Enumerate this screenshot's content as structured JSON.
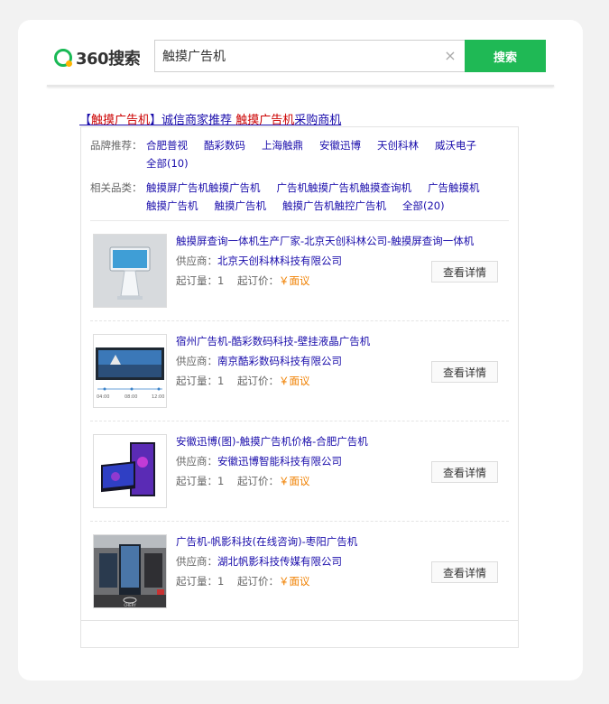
{
  "header": {
    "logo_text": "360搜索",
    "search_value": "触摸广告机",
    "clear_symbol": "×",
    "search_button": "搜索"
  },
  "ad": {
    "title_bracket_open": "【",
    "title_keyword": "触摸广告机",
    "title_bracket_close": "】",
    "title_middle": "诚信商家推荐 ",
    "title_keyword2": "触摸广告机",
    "title_end": "采购商机"
  },
  "brands": {
    "label": "品牌推荐：",
    "items": [
      "合肥普视",
      "酷彩数码",
      "上海触鼎",
      "安徽迅博",
      "天创科林",
      "威沃电子",
      "全部(10)"
    ]
  },
  "related": {
    "label": "相关品类：",
    "items": [
      "触摸屏广告机触摸广告机",
      "广告机触摸广告机触摸查询机",
      "广告触摸机",
      "触摸广告机",
      "触摸广告机",
      "触摸广告机触控广告机",
      "全部(20)"
    ]
  },
  "products": [
    {
      "title": "触摸屏查询一体机生产厂家-北京天创科林公司-触摸屏查询一体机",
      "supplier_label": "供应商：",
      "supplier": "北京天创科林科技有限公司",
      "moq_label": "起订量：",
      "moq": "1",
      "price_label": "起订价：",
      "price": "￥面议",
      "button": "查看详情"
    },
    {
      "title": "宿州广告机-酷彩数码科技-壁挂液晶广告机",
      "supplier_label": "供应商：",
      "supplier": "南京酷彩数码科技有限公司",
      "moq_label": "起订量：",
      "moq": "1",
      "price_label": "起订价：",
      "price": "￥面议",
      "button": "查看详情",
      "thumb_times": [
        "04:00",
        "08:00",
        "12:00"
      ]
    },
    {
      "title": "安徽迅博(图)-触摸广告机价格-合肥广告机",
      "supplier_label": "供应商：",
      "supplier": "安徽迅博智能科技有限公司",
      "moq_label": "起订量：",
      "moq": "1",
      "price_label": "起订价：",
      "price": "￥面议",
      "button": "查看详情"
    },
    {
      "title": "广告机-帆影科技(在线咨询)-枣阳广告机",
      "supplier_label": "供应商：",
      "supplier": "湖北帆影科技传媒有限公司",
      "moq_label": "起订量：",
      "moq": "1",
      "price_label": "起订价：",
      "price": "￥面议",
      "button": "查看详情",
      "thumb_logo": "CHERY"
    }
  ],
  "colors": {
    "accent_green": "#1fb955",
    "link_blue": "#1a0dab",
    "keyword_red": "#cc0000",
    "price_orange": "#f08000"
  }
}
